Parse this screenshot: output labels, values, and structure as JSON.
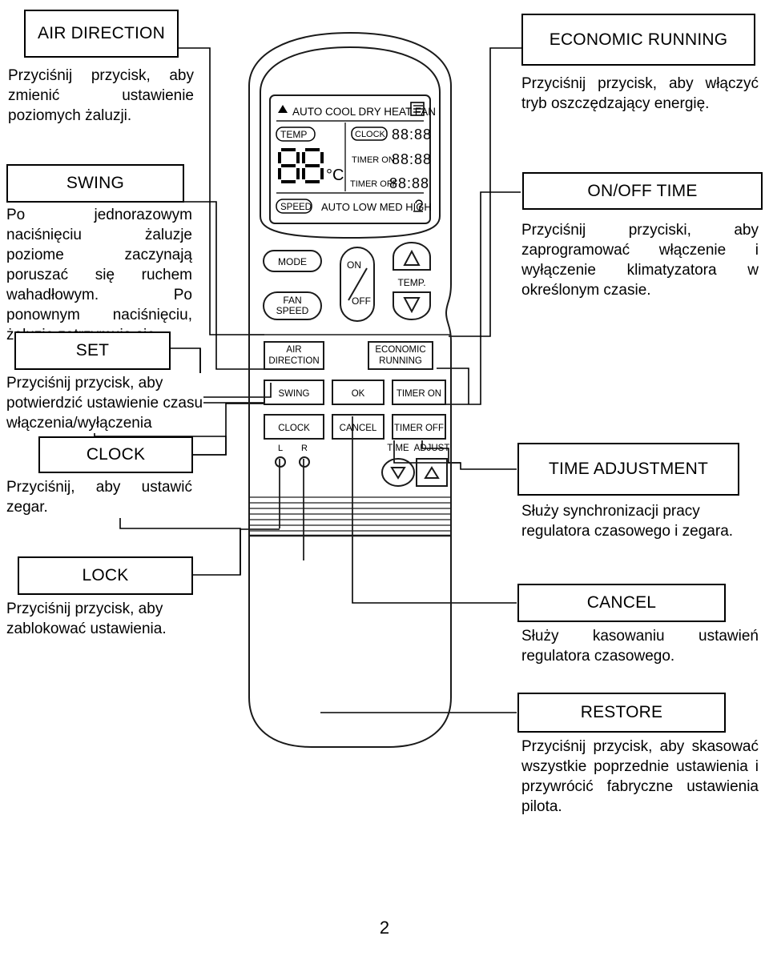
{
  "page": {
    "number": "2"
  },
  "callouts": {
    "air_direction": {
      "title": "AIR DIRECTION",
      "text": "Przyciśnij przycisk, aby zmienić ustawienie poziomych żaluzji."
    },
    "swing": {
      "title": "SWING",
      "text": "Po jednorazowym naciśnięciu żaluzje poziome zaczynają poruszać się ruchem wahadłowym. Po ponownym naciśnięciu, żaluzje zatrzymują się."
    },
    "set": {
      "title": "SET",
      "text": "Przyciśnij przycisk, aby potwierdzić ustawienie czasu włączenia/wyłączenia"
    },
    "clock": {
      "title": "CLOCK",
      "text": "Przyciśnij, aby ustawić zegar."
    },
    "lock": {
      "title": "LOCK",
      "text": "Przyciśnij przycisk, aby zablokować ustawienia."
    },
    "economic_running": {
      "title": "ECONOMIC RUNNING",
      "text": "Przyciśnij przycisk, aby włączyć tryb oszczędzający energię."
    },
    "on_off_time": {
      "title": "ON/OFF TIME",
      "text": "Przyciśnij przyciski, aby zaprogramować włączenie i wyłączenie klimatyzatora w określonym czasie."
    },
    "time_adjustment": {
      "title": "TIME ADJUSTMENT",
      "text": "Służy synchronizacji pracy regulatora czasowego i zegara."
    },
    "cancel": {
      "title": "CANCEL",
      "text": "Służy kasowaniu ustawień regulatora czasowego."
    },
    "restore": {
      "title": "RESTORE",
      "text": "Przyciśnij przycisk, aby skasować wszystkie poprzednie ustawienia i przywrócić fabryczne ustawienia pilota."
    }
  },
  "remote": {
    "lcd": {
      "mode_row": [
        "AUTO",
        "COOL",
        "DRY",
        "HEAT",
        "FAN"
      ],
      "mode_arrow": "▲",
      "signal_icon": "signal-icon",
      "temp_tag": "TEMP",
      "temp_value": "88",
      "temp_unit": "°C",
      "clock_tag": "CLOCK",
      "clock_value": "88:88",
      "timer_on_tag": "TIMER ON",
      "timer_on_value": "88:88",
      "timer_off_tag": "TIMER OFF",
      "timer_off_value": "88:88",
      "speed_tag": "SPEED",
      "speed_row": [
        "AUTO",
        "LOW",
        "MED",
        "HIGH"
      ],
      "lock_icon": "lock-icon"
    },
    "buttons": {
      "mode": "MODE",
      "fan_speed_1": "FAN",
      "fan_speed_2": "SPEED",
      "on": "ON",
      "off": "OFF",
      "temp_up": "△",
      "temp_label": "TEMP.",
      "temp_down": "▽",
      "air_direction_1": "AIR",
      "air_direction_2": "DIRECTION",
      "economic_1": "ECONOMIC",
      "economic_2": "RUNNING",
      "swing": "SWING",
      "ok": "OK",
      "timer_on": "TIMER ON",
      "clock": "CLOCK",
      "cancel": "CANCEL",
      "timer_off": "TIMER OFF",
      "time_label": "TIME",
      "adjust_label": "ADJUST",
      "time_down": "▽",
      "adjust_up": "△",
      "pin_l": "L",
      "pin_r": "R"
    }
  }
}
